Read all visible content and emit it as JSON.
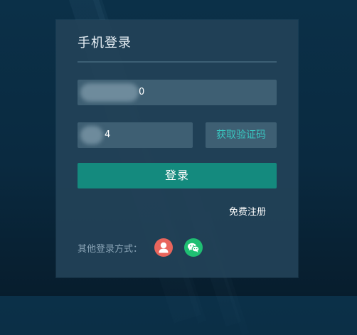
{
  "login": {
    "title": "手机登录",
    "phone_value_visible": "0",
    "code_value_visible": "4",
    "get_code_label": "获取验证码",
    "login_label": "登录",
    "register_label": "免费注册",
    "other_methods_label": "其他登录方式："
  },
  "social": {
    "account_icon": "user-icon",
    "wechat_icon": "wechat-icon"
  },
  "colors": {
    "panel": "#234258",
    "input": "#3e5f73",
    "accent_text": "#39c6c0",
    "login_button": "#148a7e",
    "account_circle": "#e9655c",
    "wechat_circle": "#1fbf73"
  }
}
